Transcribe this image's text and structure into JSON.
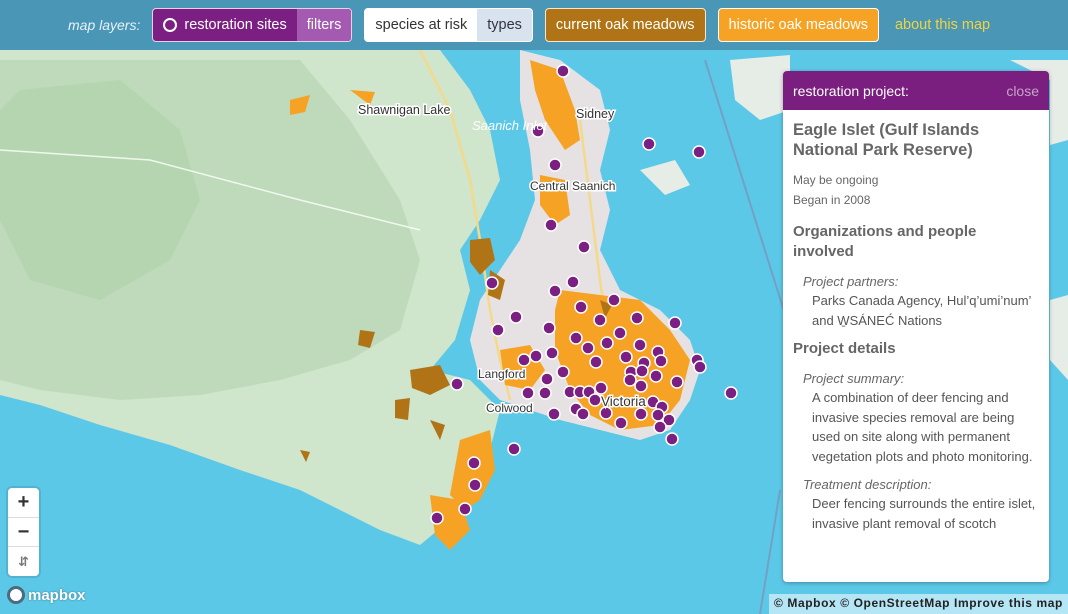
{
  "topbar": {
    "layers_label": "map layers:",
    "restoration_label": "restoration sites",
    "restoration_sub": "filters",
    "species_label": "species at risk",
    "species_sub": "types",
    "current_label": "current oak meadows",
    "historic_label": "historic oak meadows",
    "about_label": "about this map"
  },
  "map": {
    "place_labels": [
      "Shawnigan Lake",
      "Saanich Inlet",
      "Sidney",
      "Central Saanich",
      "Langford",
      "Colwood",
      "Victoria"
    ],
    "colors": {
      "water": "#5cc8e8",
      "land": "#cfe5cc",
      "historic_oak": "#f5a225",
      "current_oak": "#b07416",
      "restoration_site": "#7b1f82"
    }
  },
  "panel": {
    "header": "restoration project:",
    "close_label": "close",
    "title": "Eagle Islet (Gulf Islands National Park Reserve)",
    "status": "May be ongoing",
    "began": "Began in 2008",
    "org_heading": "Organizations and people involved",
    "partners_label": "Project partners:",
    "partners_text": "Parks Canada Agency, Hul’q’umi’num’ and W̱SÁNEĆ Nations",
    "details_heading": "Project details",
    "summary_label": "Project summary:",
    "summary_text": "A combination of deer fencing and invasive species removal are being used on site along with permanent vegetation plots and photo monitoring.",
    "treatment_label": "Treatment description:",
    "treatment_text": "Deer fencing surrounds the entire islet, invasive plant removal of scotch"
  },
  "controls": {
    "zoom_in": "+",
    "zoom_out": "−",
    "compass": "⇵"
  },
  "footer": {
    "logo_text": "mapbox",
    "attribution": "© Mapbox © OpenStreetMap Improve this map"
  }
}
